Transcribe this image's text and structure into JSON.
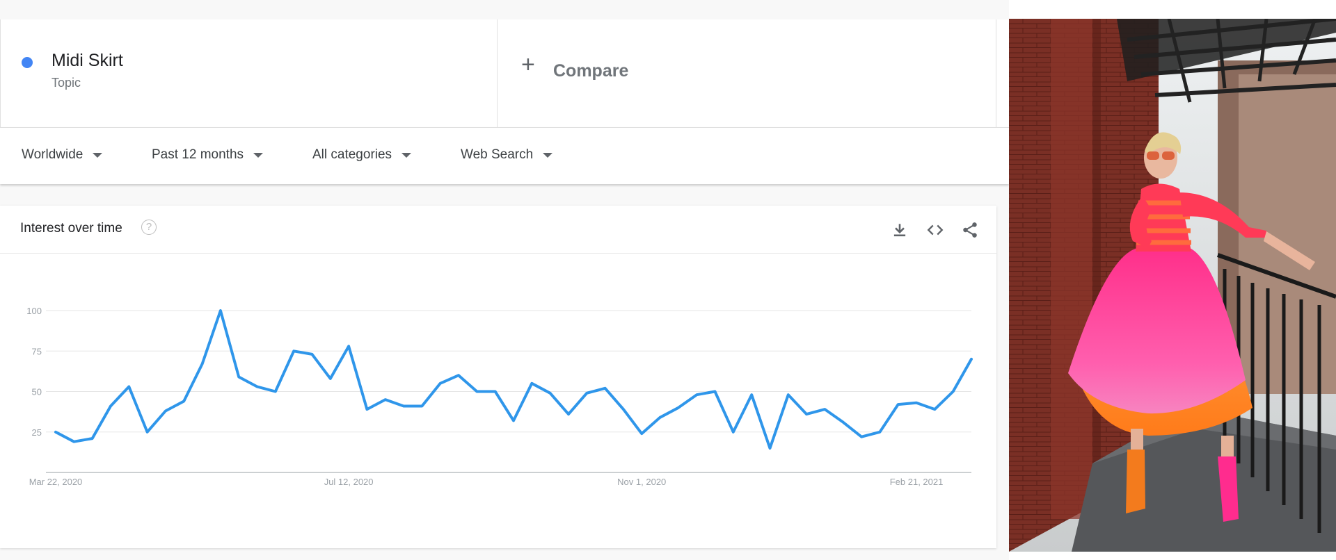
{
  "search_term": {
    "name": "Midi Skirt",
    "type": "Topic",
    "color": "#4285f4"
  },
  "compare": {
    "label": "Compare"
  },
  "filters": {
    "region": "Worldwide",
    "time": "Past 12 months",
    "category": "All categories",
    "property": "Web Search"
  },
  "card": {
    "title": "Interest over time",
    "icons": [
      "help-icon",
      "download-icon",
      "embed-icon",
      "share-icon"
    ]
  },
  "chart_data": {
    "type": "line",
    "title": "",
    "xlabel": "",
    "ylabel": "",
    "ylim": [
      0,
      100
    ],
    "y_ticks": [
      "25",
      "50",
      "75",
      "100"
    ],
    "x_ticks": [
      {
        "label": "Mar 22, 2020",
        "index": 0
      },
      {
        "label": "Jul 12, 2020",
        "index": 16
      },
      {
        "label": "Nov 1, 2020",
        "index": 32
      },
      {
        "label": "Feb 21, 2021",
        "index": 47
      }
    ],
    "grid": true,
    "series": [
      {
        "color": "#2f96ea",
        "values": [
          25,
          19,
          21,
          41,
          53,
          25,
          38,
          44,
          67,
          100,
          59,
          53,
          50,
          75,
          73,
          58,
          78,
          39,
          45,
          41,
          41,
          55,
          60,
          50,
          50,
          32,
          55,
          49,
          36,
          49,
          52,
          39,
          24,
          34,
          40,
          48,
          50,
          25,
          48,
          15,
          48,
          36,
          39,
          31,
          22,
          25,
          42,
          43,
          39,
          50,
          70
        ]
      }
    ]
  }
}
